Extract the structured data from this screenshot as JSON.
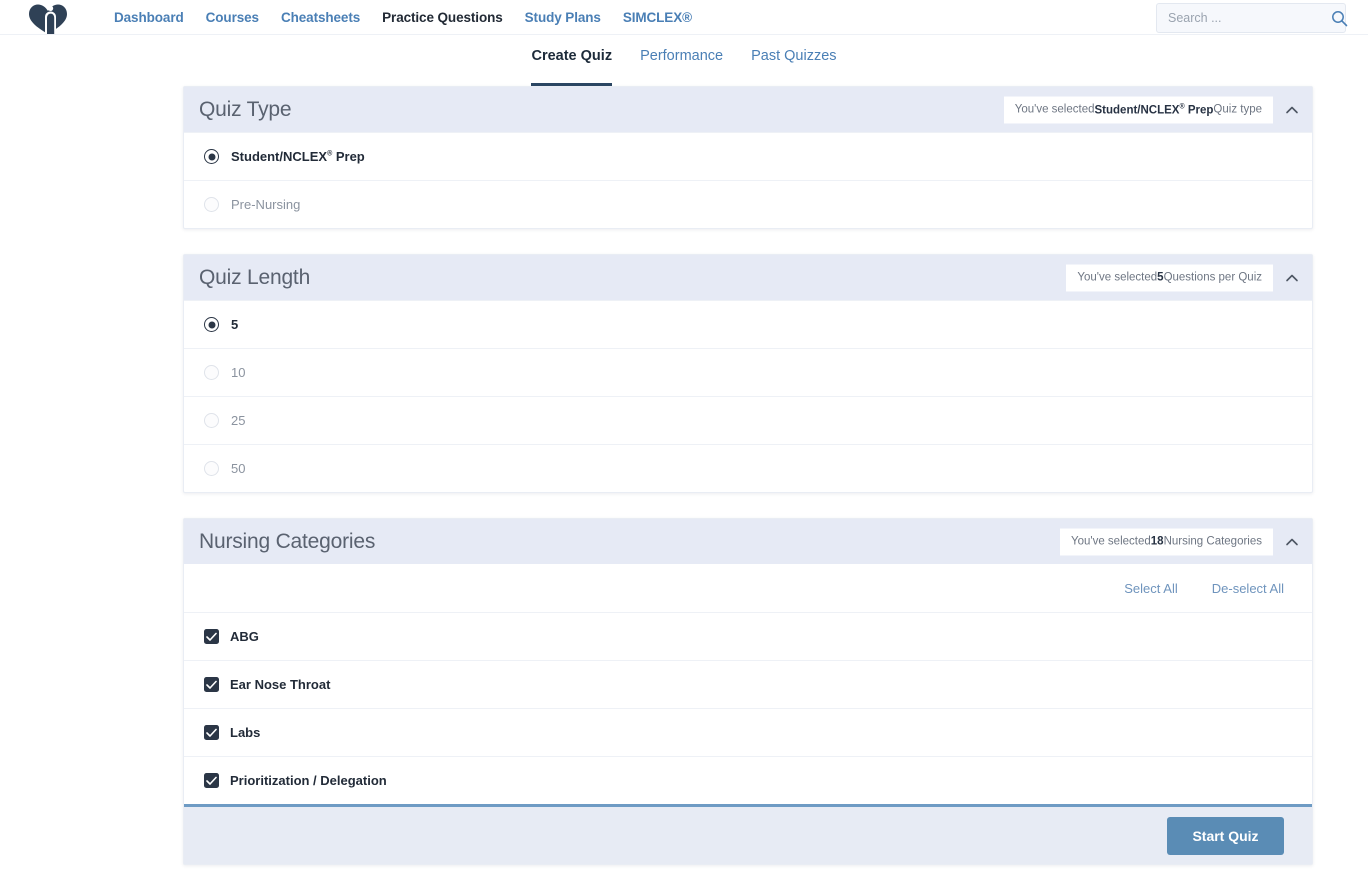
{
  "brand": {
    "logo_icon": "nurse-heart-logo-icon"
  },
  "nav": {
    "links": [
      {
        "label": "Dashboard",
        "active": false
      },
      {
        "label": "Courses",
        "active": false
      },
      {
        "label": "Cheatsheets",
        "active": false
      },
      {
        "label": "Practice Questions",
        "active": true
      },
      {
        "label": "Study Plans",
        "active": false
      },
      {
        "label": "SIMCLEX®",
        "active": false
      }
    ],
    "search": {
      "placeholder": "Search ...",
      "value": "",
      "icon": "search-icon"
    }
  },
  "tabs": [
    {
      "label": "Create Quiz",
      "active": true
    },
    {
      "label": "Performance",
      "active": false
    },
    {
      "label": "Past Quizzes",
      "active": false
    }
  ],
  "quiz_type": {
    "title": "Quiz Type",
    "pill_prefix": "You've selected ",
    "pill_value": "Student/NCLEX® Prep",
    "pill_suffix": " Quiz type",
    "collapse_icon": "chevron-up-icon",
    "options": [
      {
        "label": "Student/NCLEX® Prep",
        "selected": true
      },
      {
        "label": "Pre-Nursing",
        "selected": false
      }
    ]
  },
  "quiz_length": {
    "title": "Quiz Length",
    "pill_prefix": "You've selected ",
    "pill_value": "5",
    "pill_suffix": " Questions per Quiz",
    "collapse_icon": "chevron-up-icon",
    "options": [
      {
        "label": "5",
        "selected": true
      },
      {
        "label": "10",
        "selected": false
      },
      {
        "label": "25",
        "selected": false
      },
      {
        "label": "50",
        "selected": false
      }
    ]
  },
  "nursing_categories": {
    "title": "Nursing Categories",
    "pill_prefix": "You've selected ",
    "pill_value": "18",
    "pill_suffix": " Nursing Categories",
    "collapse_icon": "chevron-up-icon",
    "select_all_label": "Select All",
    "deselect_all_label": "De-select All",
    "items": [
      {
        "label": "ABG",
        "checked": true
      },
      {
        "label": "Ear Nose Throat",
        "checked": true
      },
      {
        "label": "Labs",
        "checked": true
      },
      {
        "label": "Prioritization / Delegation",
        "checked": true
      }
    ]
  },
  "footer": {
    "start_label": "Start Quiz"
  },
  "colors": {
    "brand_navy": "#2b3646",
    "link_blue": "#4a7fb5",
    "card_header_bg": "#e6eaf5",
    "start_button": "#5a8cb5",
    "footer_border": "#6e9bc4"
  }
}
